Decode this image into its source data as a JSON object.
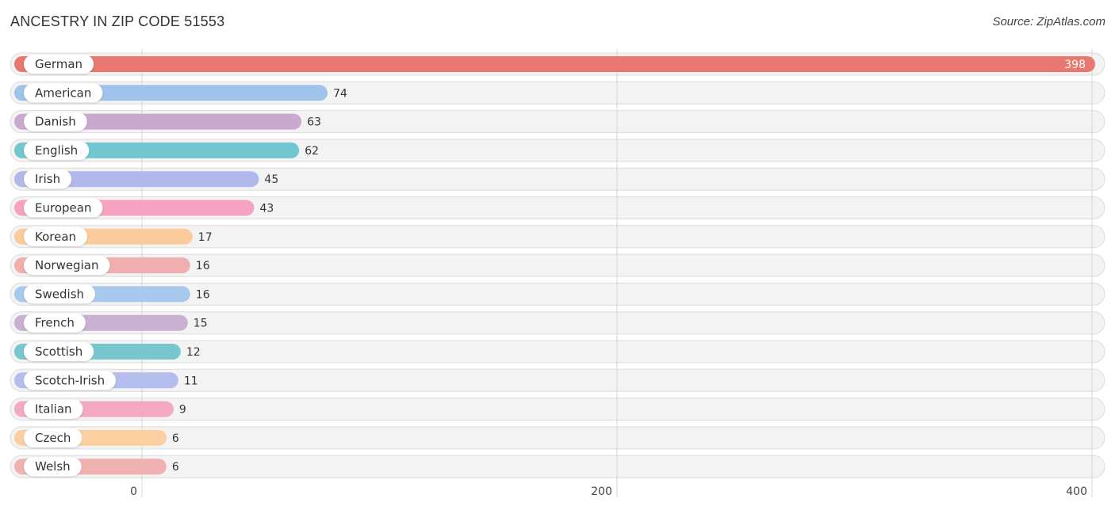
{
  "chart_data": {
    "type": "bar",
    "orientation": "horizontal",
    "title": "ANCESTRY IN ZIP CODE 51553",
    "source": "Source: ZipAtlas.com",
    "xlabel": "",
    "ylabel": "",
    "xlim": [
      0,
      400
    ],
    "xticks": [
      0,
      200,
      400
    ],
    "grid": true,
    "categories": [
      "German",
      "American",
      "Danish",
      "English",
      "Irish",
      "European",
      "Korean",
      "Norwegian",
      "Swedish",
      "French",
      "Scottish",
      "Scotch-Irish",
      "Italian",
      "Czech",
      "Welsh"
    ],
    "values": [
      398,
      74,
      63,
      62,
      45,
      43,
      17,
      16,
      16,
      15,
      12,
      11,
      9,
      6,
      6
    ],
    "colors": [
      "#e8776f",
      "#9fc3ea",
      "#c9a9d0",
      "#72c6cf",
      "#b1b9ea",
      "#f5a3c0",
      "#fccb9c",
      "#f0aeae",
      "#a7c9ee",
      "#c9afd4",
      "#78c7cf",
      "#b4bdee",
      "#f5a8c3",
      "#fccfa1",
      "#f0b1b1"
    ]
  }
}
